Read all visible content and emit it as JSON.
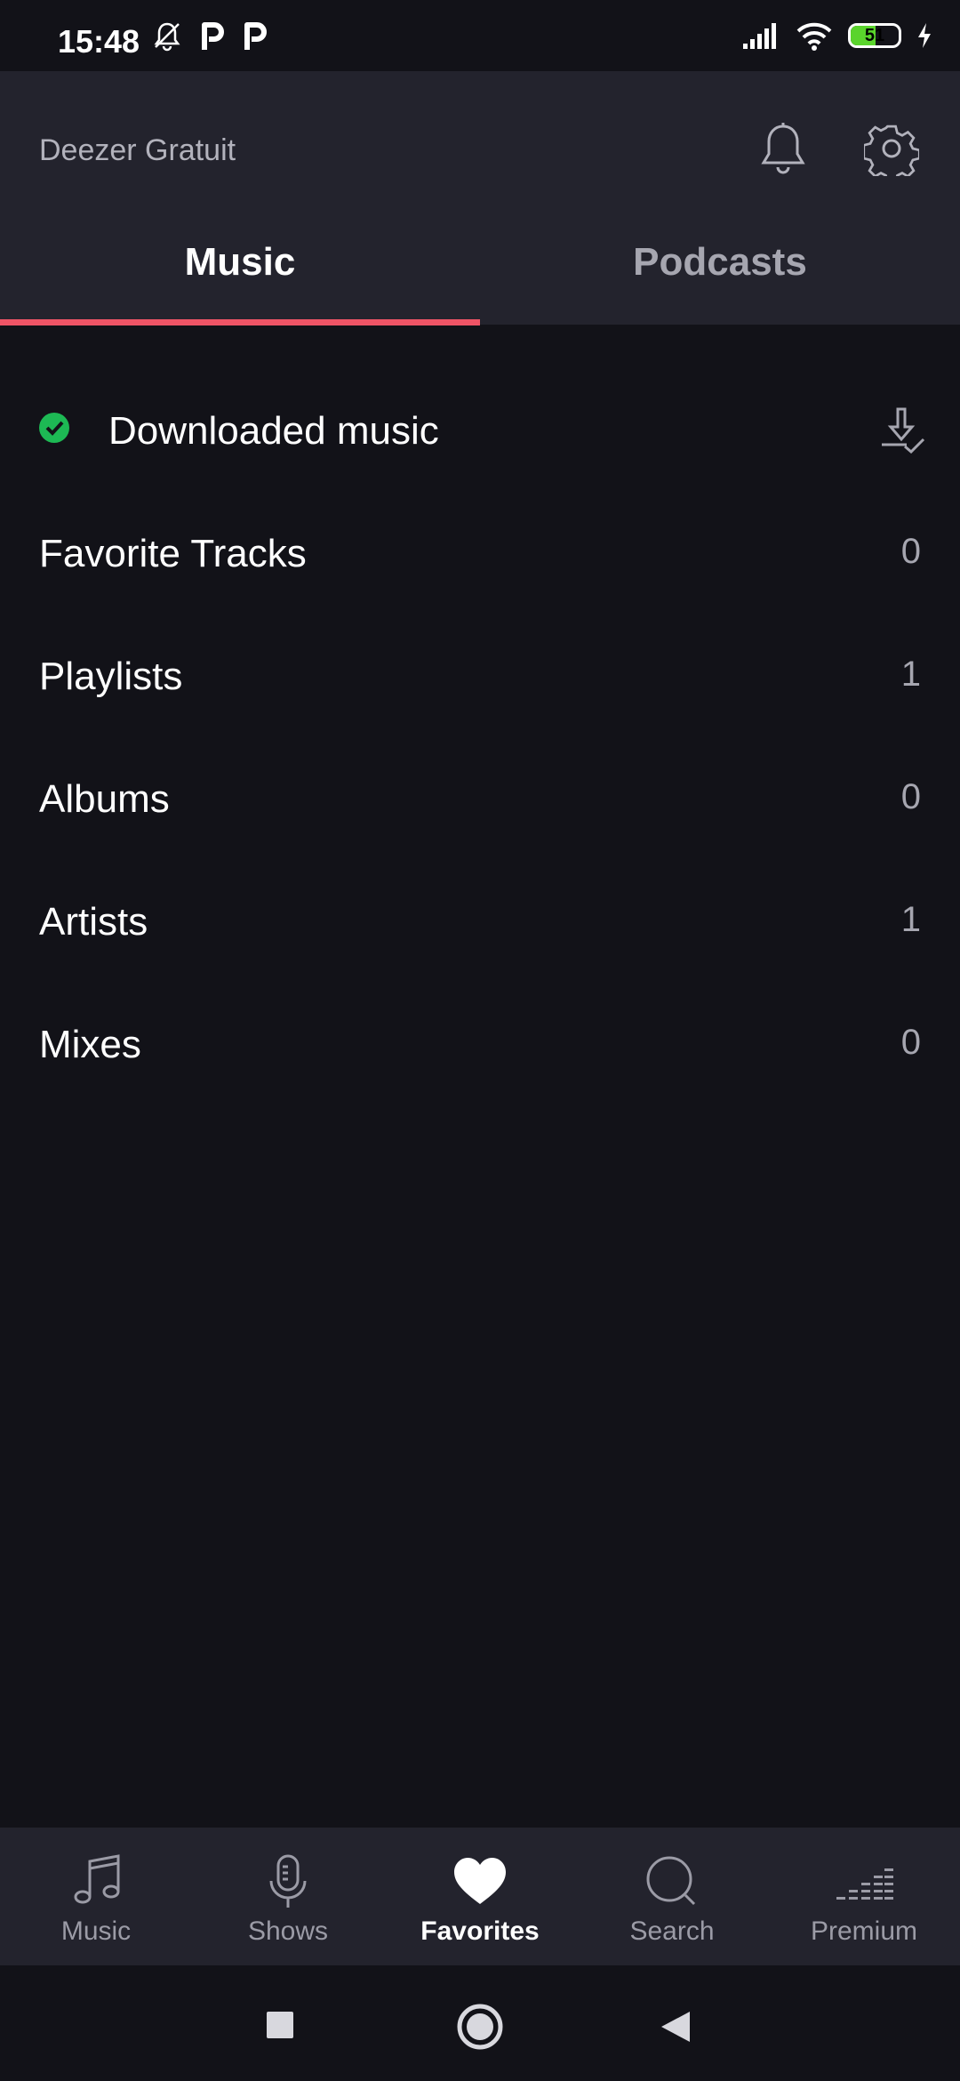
{
  "status_bar": {
    "time": "15:48",
    "battery_level": 51,
    "battery_label": "51",
    "icons": [
      "bell-muted-icon",
      "p-app-icon",
      "p-app-icon",
      "signal-icon",
      "wifi-icon",
      "battery-icon",
      "charging-icon"
    ]
  },
  "header": {
    "brand": "Deezer Gratuit",
    "icons": [
      "bell-icon",
      "gear-icon"
    ]
  },
  "tabs": [
    {
      "label": "Music",
      "selected": true
    },
    {
      "label": "Podcasts",
      "selected": false
    }
  ],
  "list": {
    "downloaded": {
      "label": "Downloaded music"
    },
    "items": [
      {
        "label": "Favorite Tracks",
        "count": "0"
      },
      {
        "label": "Playlists",
        "count": "1"
      },
      {
        "label": "Albums",
        "count": "0"
      },
      {
        "label": "Artists",
        "count": "1"
      },
      {
        "label": "Mixes",
        "count": "0"
      }
    ]
  },
  "bottom_nav": [
    {
      "label": "Music",
      "icon": "music-note-icon",
      "active": false
    },
    {
      "label": "Shows",
      "icon": "microphone-icon",
      "active": false
    },
    {
      "label": "Favorites",
      "icon": "heart-icon",
      "active": true
    },
    {
      "label": "Search",
      "icon": "search-icon",
      "active": false
    },
    {
      "label": "Premium",
      "icon": "equalizer-icon",
      "active": false
    }
  ],
  "colors": {
    "accent": "#ef5466",
    "background": "#121218",
    "header": "#23232d",
    "success": "#1db954"
  }
}
